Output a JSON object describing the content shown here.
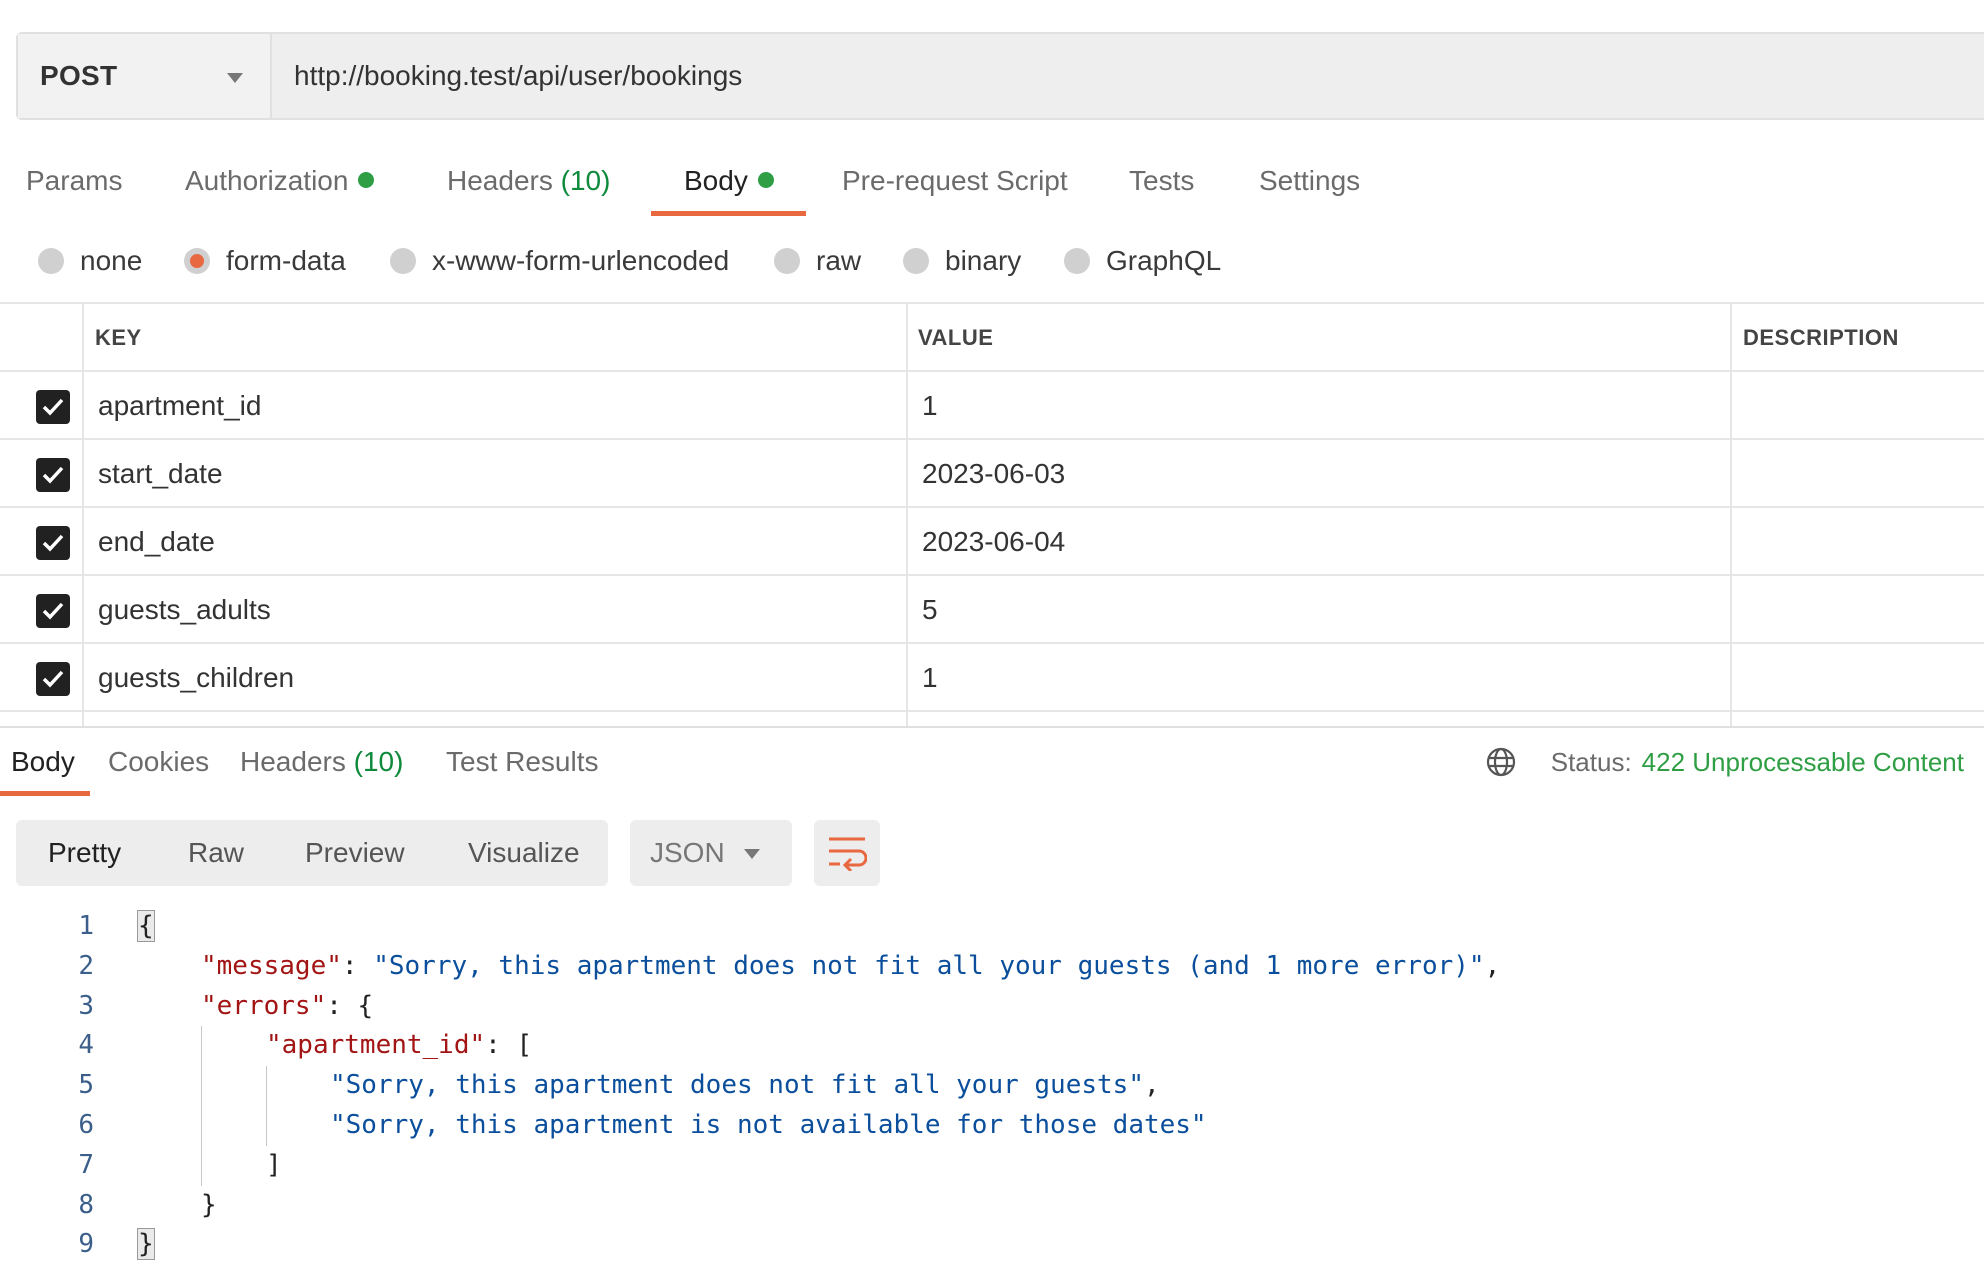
{
  "request": {
    "method": "POST",
    "url": "http://booking.test/api/user/bookings"
  },
  "request_tabs": {
    "params": "Params",
    "authorization": "Authorization",
    "headers": "Headers",
    "headers_count": "(10)",
    "body": "Body",
    "prerequest": "Pre-request Script",
    "tests": "Tests",
    "settings": "Settings",
    "active": "Body"
  },
  "body_types": {
    "none": "none",
    "form_data": "form-data",
    "urlencoded": "x-www-form-urlencoded",
    "raw": "raw",
    "binary": "binary",
    "graphql": "GraphQL",
    "selected": "form-data"
  },
  "params_table": {
    "headers": {
      "key": "KEY",
      "value": "VALUE",
      "description": "DESCRIPTION"
    },
    "rows": [
      {
        "key": "apartment_id",
        "value": "1",
        "checked": true
      },
      {
        "key": "start_date",
        "value": "2023-06-03",
        "checked": true
      },
      {
        "key": "end_date",
        "value": "2023-06-04",
        "checked": true
      },
      {
        "key": "guests_adults",
        "value": "5",
        "checked": true
      },
      {
        "key": "guests_children",
        "value": "1",
        "checked": true
      }
    ]
  },
  "response_tabs": {
    "body": "Body",
    "cookies": "Cookies",
    "headers": "Headers",
    "headers_count": "(10)",
    "test_results": "Test Results"
  },
  "status": {
    "label": "Status:",
    "value": "422 Unprocessable Content"
  },
  "view_modes": {
    "pretty": "Pretty",
    "raw": "Raw",
    "preview": "Preview",
    "visualize": "Visualize",
    "format": "JSON",
    "active": "Pretty"
  },
  "response_body": {
    "line_numbers": [
      "1",
      "2",
      "3",
      "4",
      "5",
      "6",
      "7",
      "8",
      "9"
    ],
    "message_key": "\"message\"",
    "message_value": "\"Sorry, this apartment does not fit all your guests (and 1 more error)\"",
    "errors_key": "\"errors\"",
    "apartment_id_key": "\"apartment_id\"",
    "error_1": "\"Sorry, this apartment does not fit all your guests\"",
    "error_2": "\"Sorry, this apartment is not available for those dates\"",
    "open_brace": "{",
    "close_brace": "}",
    "open_bracket": "[",
    "close_bracket": "]",
    "colon_brace": ": {",
    "colon_bracket": ": [",
    "colon_space": ": ",
    "comma": ","
  },
  "colors": {
    "accent": "#e8683f",
    "status_ok": "#2f9e44",
    "json_key": "#a31515",
    "json_string": "#0b4f9c"
  },
  "icons": {
    "method_caret": "chevron-down-icon",
    "checkbox": "check-icon",
    "globe": "globe-icon",
    "wrap": "wrap-lines-icon"
  }
}
